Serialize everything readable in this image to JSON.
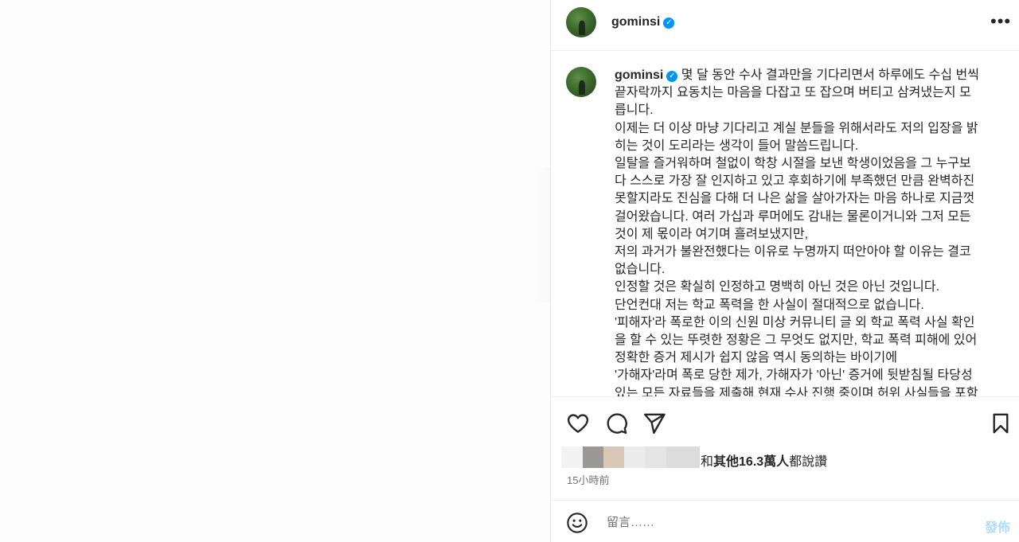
{
  "header": {
    "username": "gominsi",
    "verified_badge": "✓",
    "more_label": "•••"
  },
  "caption": {
    "username": "gominsi",
    "verified_badge": "✓",
    "lines": [
      "몇 달 동안 수사 결과만을 기다리면서 하루에도 수십 번씩",
      "끝자락까지 요동치는 마음을 다잡고 또 잡으며 버티고 삼켜냈는지 모",
      "릅니다.",
      "이제는 더 이상 마냥 기다리고 계실 분들을 위해서라도 저의 입장을 밝",
      "히는 것이 도리라는 생각이 들어 말씀드립니다.",
      "일탈을 즐거워하며 철없이 학창 시절을 보낸 학생이었음을 그 누구보",
      "다 스스로 가장 잘 인지하고 있고 후회하기에 부족했던 만큼 완벽하진",
      "못할지라도 진심을 다해 더 나은 삶을 살아가자는 마음 하나로 지금껏",
      "걸어왔습니다. 여러 가십과 루머에도 감내는 물론이거니와 그저 모든",
      "것이 제 몫이라 여기며 흘려보냈지만,",
      "저의 과거가 불완전했다는 이유로 누명까지 떠안아야 할 이유는 결코",
      "없습니다.",
      "인정할 것은 확실히 인정하고 명백히 아닌 것은 아닌 것입니다.",
      "단언컨대 저는 학교 폭력을 한 사실이 절대적으로 없습니다.",
      "'피해자'라 폭로한 이의 신원 미상 커뮤니티 글 외 학교 폭력 사실 확인",
      "을 할 수 있는 뚜렷한 정황은 그 무엇도 없지만, 학교 폭력 피해에 있어",
      "정확한 증거 제시가 쉽지 않음 역시 동의하는 바이기에",
      "'가해자'라며 폭로 당한 제가, 가해자가 '아닌' 증거에 뒷받침될 타당성",
      "있는 모든 자료들을 제출해 현재 수사 진행 중이며 허위 사실들을 포함"
    ]
  },
  "actions": {
    "like_icon": "heart-icon",
    "comment_icon": "comment-bubble-icon",
    "share_icon": "paper-plane-icon",
    "save_icon": "bookmark-icon"
  },
  "likes": {
    "prefix": "和",
    "bold": "其他16.3萬人",
    "suffix": "都說讚"
  },
  "timestamp": "15小時前",
  "comment_bar": {
    "placeholder": "留言……",
    "post_label": "發佈",
    "emoji_icon": "smiley-icon"
  },
  "colors": {
    "verified": "#0095f6",
    "post_button_disabled": "#b3dbff",
    "secondary_text": "#737373"
  }
}
